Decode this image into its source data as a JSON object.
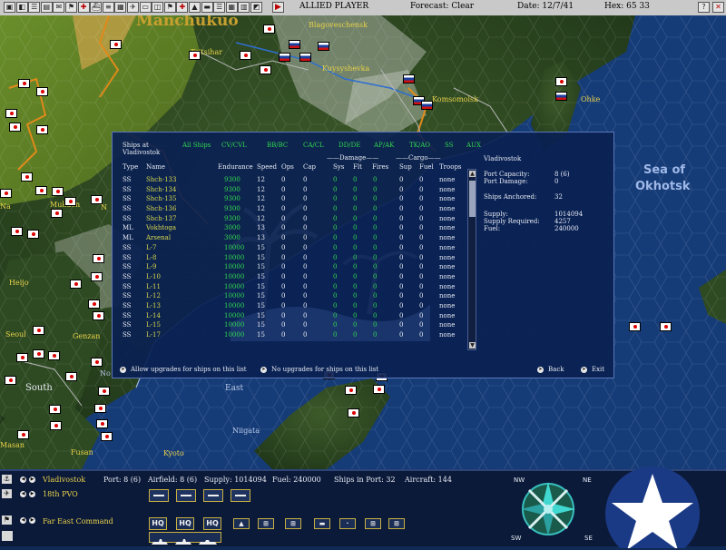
{
  "toolbar": {
    "player": "ALLIED PLAYER",
    "forecast": "Forecast: Clear",
    "date": "Date: 12/7/41",
    "hex": "Hex: 65 33",
    "icons": [
      "map-icon",
      "info-icon",
      "report-icon",
      "disk-icon",
      "intel-icon",
      "green-flag-icon",
      "red-cross-icon",
      "ship-icon",
      "list-icon",
      "cargo-icon",
      "plane-icon",
      "sub-icon",
      "group-icon",
      "flag-icon",
      "cross-icon",
      "tank-icon",
      "bar-icon",
      "menu-icon",
      "base-icon",
      "grid-icon",
      "chart-icon",
      "end-turn-icon"
    ]
  },
  "map": {
    "region_manchukuo": "Manchukuo",
    "sea_of_okhotsk_1": "Sea of",
    "sea_of_okhotsk_2": "Okhotsk",
    "places": {
      "blagoveschensk": "Blagoveschensk",
      "kuybyshevka": "Kuysyshevka",
      "komsomolsk": "Komsomolsk",
      "tsitsihar": "Tsitsihar",
      "ohka": "Ohke",
      "mukden": "Mukden",
      "heijo": "Heijo",
      "seoul": "Seoul",
      "genzan": "Genzan",
      "south": "South",
      "east": "East",
      "fusan": "Fusan",
      "niigata": "Niigata",
      "masan": "Masan",
      "kyoto": "Kyoto",
      "na": "Na",
      "n": "N",
      "n_orth": "No"
    }
  },
  "dialog": {
    "title_line1": "Ships at",
    "title_line2": "Vladivostok",
    "filters": [
      "All Ships",
      "CV/CVL",
      "BB/BC",
      "CA/CL",
      "DD/DE",
      "AP/AK",
      "TK/AO",
      "SS",
      "AUX"
    ],
    "group_damage": "Damage",
    "group_cargo": "Cargo",
    "columns": [
      "Type",
      "Name",
      "Endurance",
      "Speed",
      "Ops",
      "Cap",
      "Sys",
      "Flt",
      "Fires",
      "Sup",
      "Fuel",
      "Troops"
    ],
    "ships": [
      [
        "SS",
        "Shch-133",
        "9300",
        "12",
        "0",
        "0",
        "0",
        "0",
        "0",
        "0",
        "0",
        "none"
      ],
      [
        "SS",
        "Shch-134",
        "9300",
        "12",
        "0",
        "0",
        "0",
        "0",
        "0",
        "0",
        "0",
        "none"
      ],
      [
        "SS",
        "Shch-135",
        "9300",
        "12",
        "0",
        "0",
        "0",
        "0",
        "0",
        "0",
        "0",
        "none"
      ],
      [
        "SS",
        "Shch-136",
        "9300",
        "12",
        "0",
        "0",
        "0",
        "0",
        "0",
        "0",
        "0",
        "none"
      ],
      [
        "SS",
        "Shch-137",
        "9300",
        "12",
        "0",
        "0",
        "0",
        "0",
        "0",
        "0",
        "0",
        "none"
      ],
      [
        "ML",
        "Vokhtoga",
        "3000",
        "13",
        "0",
        "0",
        "0",
        "0",
        "0",
        "0",
        "0",
        "none"
      ],
      [
        "ML",
        "Arsenal",
        "3000",
        "13",
        "0",
        "0",
        "0",
        "0",
        "0",
        "0",
        "0",
        "none"
      ],
      [
        "SS",
        "L-7",
        "10000",
        "15",
        "0",
        "0",
        "0",
        "0",
        "0",
        "0",
        "0",
        "none"
      ],
      [
        "SS",
        "L-8",
        "10000",
        "15",
        "0",
        "0",
        "0",
        "0",
        "0",
        "0",
        "0",
        "none"
      ],
      [
        "SS",
        "L-9",
        "10000",
        "15",
        "0",
        "0",
        "0",
        "0",
        "0",
        "0",
        "0",
        "none"
      ],
      [
        "SS",
        "L-10",
        "10000",
        "15",
        "0",
        "0",
        "0",
        "0",
        "0",
        "0",
        "0",
        "none"
      ],
      [
        "SS",
        "L-11",
        "10000",
        "15",
        "0",
        "0",
        "0",
        "0",
        "0",
        "0",
        "0",
        "none"
      ],
      [
        "SS",
        "L-12",
        "10000",
        "15",
        "0",
        "0",
        "0",
        "0",
        "0",
        "0",
        "0",
        "none"
      ],
      [
        "SS",
        "L-13",
        "10000",
        "15",
        "0",
        "0",
        "0",
        "0",
        "0",
        "0",
        "0",
        "none"
      ],
      [
        "SS",
        "L-14",
        "10000",
        "15",
        "0",
        "0",
        "0",
        "0",
        "0",
        "0",
        "0",
        "none"
      ],
      [
        "SS",
        "L-15",
        "10000",
        "15",
        "0",
        "0",
        "0",
        "0",
        "0",
        "0",
        "0",
        "none"
      ],
      [
        "SS",
        "L-17",
        "10000",
        "15",
        "0",
        "0",
        "0",
        "0",
        "0",
        "0",
        "0",
        "none"
      ]
    ],
    "port": {
      "name": "Vladivostok",
      "capacity_label": "Port Capacity:",
      "capacity_value": "8 (6)",
      "damage_label": "Port Damage:",
      "damage_value": "0",
      "anchored_label": "Ships Anchored:",
      "anchored_value": "32",
      "supply_label": "Supply:",
      "supply_value": "1014094",
      "supply_req_label": "Supply Required:",
      "supply_req_value": "4257",
      "fuel_label": "Fuel:",
      "fuel_value": "240000"
    },
    "allow_upgrades": "Allow upgrades for ships on this list",
    "no_upgrades": "No upgrades for ships on this list",
    "back": "Back",
    "exit": "Exit"
  },
  "bottom": {
    "base": "Vladivostok",
    "unit": "18th PVO",
    "command": "Far East Command",
    "port": "Port: 8 (6)",
    "airfield": "Airfield: 8 (6)",
    "supply": "Supply: 1014094",
    "fuel": "Fuel: 240000",
    "ships_in_port": "Ships in Port: 32",
    "aircraft": "Aircraft: 144",
    "hq_label": "HQ",
    "compass": [
      "NW",
      "NE",
      "SW",
      "SE"
    ]
  }
}
